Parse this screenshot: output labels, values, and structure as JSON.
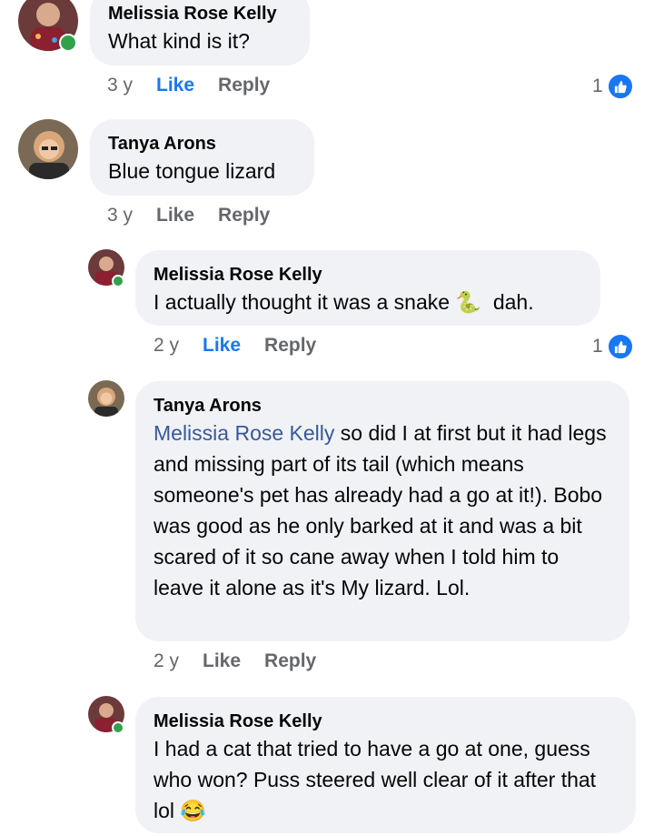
{
  "comments": [
    {
      "author": "Melissia Rose Kelly",
      "text": "What kind is it?",
      "time": "3 y",
      "like": "Like",
      "reply": "Reply",
      "reaction_count": "1"
    },
    {
      "author": "Tanya Arons",
      "text": "Blue tongue lizard",
      "time": "3 y",
      "like": "Like",
      "reply": "Reply"
    },
    {
      "author": "Melissia Rose Kelly",
      "text_before": "I actually thought it was a snake",
      "emoji": "🐍",
      "text_after": "dah.",
      "time": "2 y",
      "like": "Like",
      "reply": "Reply",
      "reaction_count": "1"
    },
    {
      "author": "Tanya Arons",
      "mention": "Melissia Rose Kelly",
      "text": " so did I at first but it had legs and missing part of its tail (which means someone's pet has already had a go at it!). Bobo was good as he only barked at it and was a bit scared of it so cane away when I  told him to leave it alone as it's My lizard.   Lol.",
      "time": "2 y",
      "like": "Like",
      "reply": "Reply"
    },
    {
      "author": "Melissia Rose Kelly",
      "text": "I had  a  cat  that tried to have  a go at one, guess who won?  Puss steered  well  clear of it after that lol",
      "emoji": "😂"
    }
  ],
  "colors": {
    "like_active": "#1877f2",
    "bubble": "#f0f2f5",
    "meta": "#65676b",
    "mention": "#385898",
    "online": "#31a24c"
  }
}
